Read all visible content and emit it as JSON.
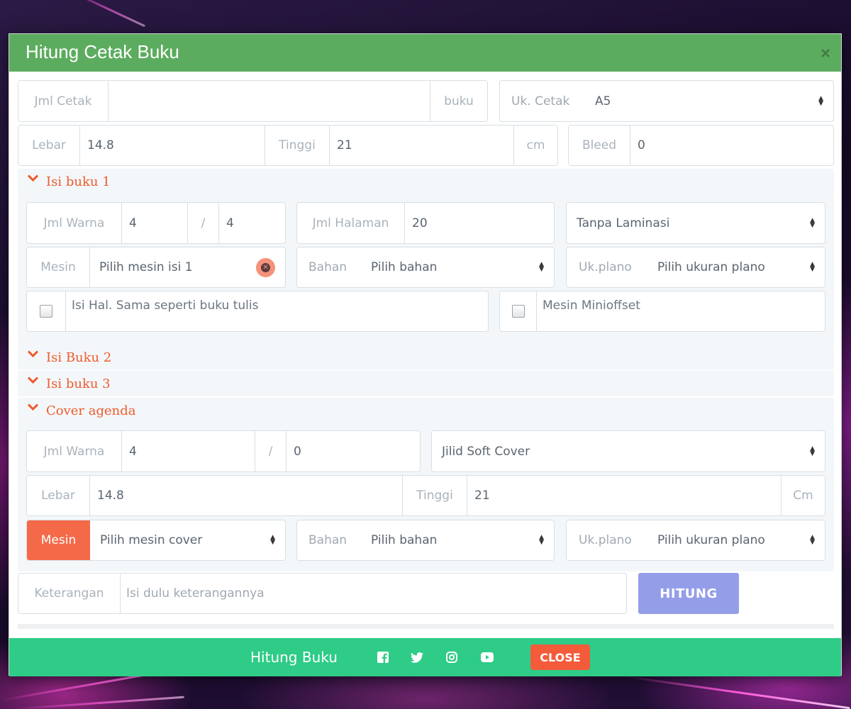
{
  "modal": {
    "title": "Hitung Cetak Buku",
    "close_symbol": "×"
  },
  "top": {
    "jml_cetak": {
      "label": "Jml Cetak",
      "value": "",
      "unit": "buku"
    },
    "uk_cetak": {
      "label": "Uk. Cetak",
      "value": "A5"
    },
    "lebar": {
      "label": "Lebar",
      "value": "14.8"
    },
    "tinggi": {
      "label": "Tinggi",
      "value": "21",
      "unit": "cm"
    },
    "bleed": {
      "label": "Bleed",
      "value": "0"
    }
  },
  "isi_buku_1": {
    "title": "Isi buku 1",
    "jml_warna": {
      "label": "Jml Warna",
      "front": "4",
      "sep": "/",
      "back": "4"
    },
    "jml_halaman": {
      "label": "Jml Halaman",
      "value": "20"
    },
    "laminasi": {
      "value": "Tanpa Laminasi"
    },
    "mesin": {
      "label": "Mesin",
      "value": "Pilih mesin isi 1"
    },
    "bahan": {
      "label": "Bahan",
      "value": "Pilih bahan"
    },
    "ukplano": {
      "label": "Uk.plano",
      "value": "Pilih ukuran plano"
    },
    "check_buku_tulis": {
      "label": "Isi Hal. Sama seperti buku tulis",
      "checked": false
    },
    "check_minioffset": {
      "label": "Mesin Minioffset",
      "checked": false
    }
  },
  "sections": {
    "isi_buku_2": "Isi Buku 2",
    "isi_buku_3": "Isi buku 3",
    "cover": "Cover agenda"
  },
  "cover": {
    "jml_warna": {
      "label": "Jml Warna",
      "front": "4",
      "sep": "/",
      "back": "0"
    },
    "jilid": {
      "value": "Jilid Soft Cover"
    },
    "lebar": {
      "label": "Lebar",
      "value": "14.8"
    },
    "tinggi": {
      "label": "Tinggi",
      "value": "21",
      "unit": "Cm"
    },
    "mesin": {
      "label": "Mesin",
      "value": "Pilih mesin cover"
    },
    "bahan": {
      "label": "Bahan",
      "value": "Pilih bahan"
    },
    "ukplano": {
      "label": "Uk.plano",
      "value": "Pilih ukuran plano"
    }
  },
  "keterangan": {
    "label": "Keterangan",
    "placeholder": "Isi dulu keterangannya"
  },
  "hitung_button": "HITUNG",
  "footer": {
    "title": "Hitung Buku",
    "social_icons": [
      "facebook-icon",
      "twitter-icon",
      "instagram-icon",
      "youtube-icon"
    ],
    "close_button": "CLOSE"
  },
  "colors": {
    "header": "#5cac5f",
    "footer": "#2ecc87",
    "accent": "#f05a2b",
    "hitung": "#949ee8",
    "close": "#f45b3a"
  }
}
